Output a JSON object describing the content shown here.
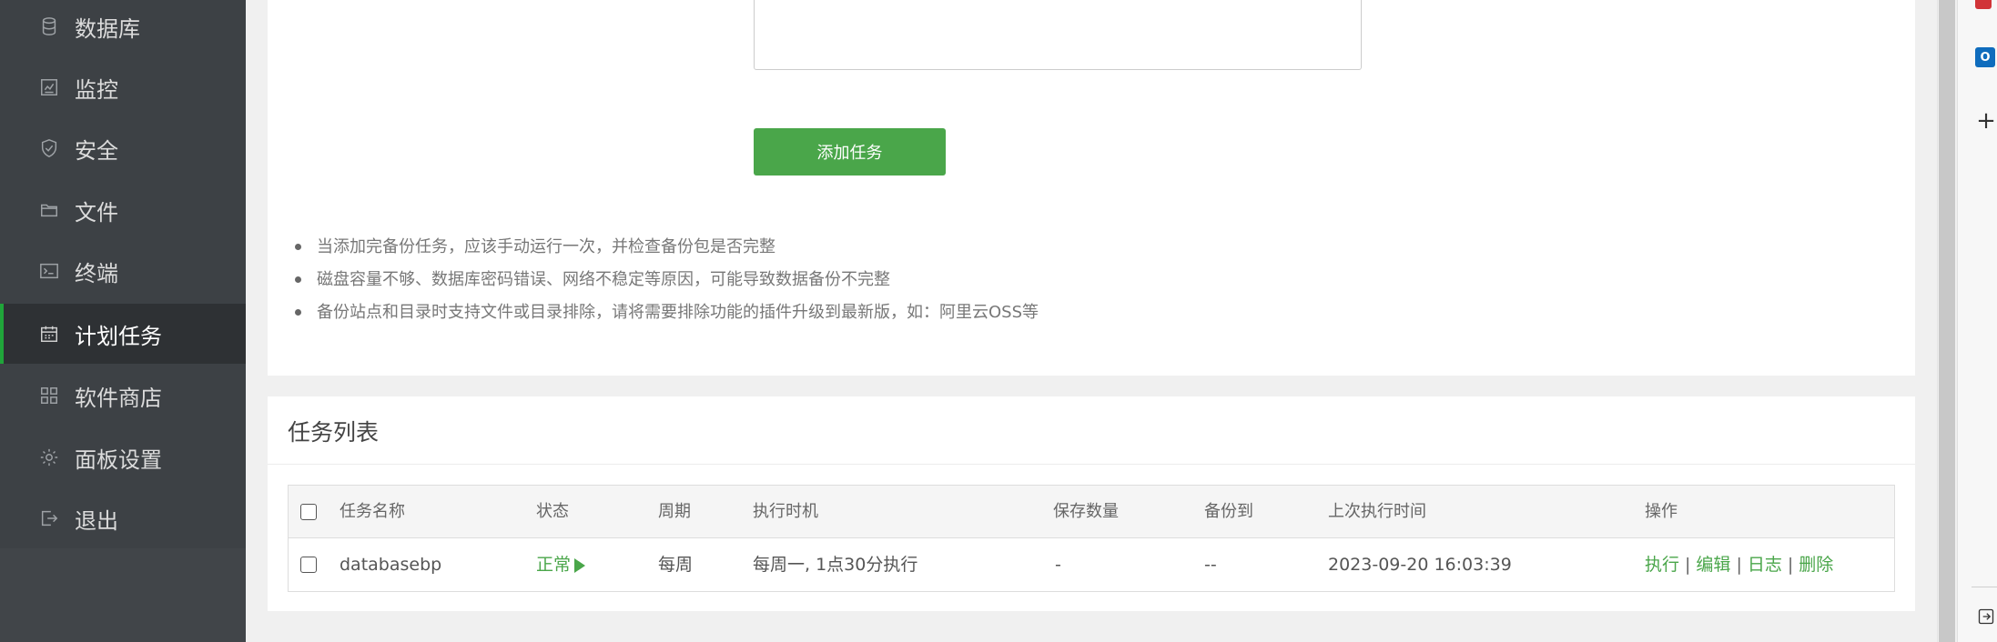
{
  "sidebar": {
    "items": [
      {
        "label": "数据库",
        "icon": "database-icon"
      },
      {
        "label": "监控",
        "icon": "monitor-icon"
      },
      {
        "label": "安全",
        "icon": "shield-icon"
      },
      {
        "label": "文件",
        "icon": "folder-icon"
      },
      {
        "label": "终端",
        "icon": "terminal-icon"
      },
      {
        "label": "计划任务",
        "icon": "calendar-icon",
        "active": true
      },
      {
        "label": "软件商店",
        "icon": "apps-grid-icon"
      },
      {
        "label": "面板设置",
        "icon": "gear-icon"
      },
      {
        "label": "退出",
        "icon": "logout-icon"
      }
    ]
  },
  "form": {
    "add_task_label": "添加任务"
  },
  "tips": [
    "当添加完备份任务，应该手动运行一次，并检查备份包是否完整",
    "磁盘容量不够、数据库密码错误、网络不稳定等原因，可能导致数据备份不完整",
    "备份站点和目录时支持文件或目录排除，请将需要排除功能的插件升级到最新版，如：阿里云OSS等"
  ],
  "task_list": {
    "title": "任务列表",
    "columns": {
      "name": "任务名称",
      "status": "状态",
      "period": "周期",
      "exec_time": "执行时机",
      "keep_count": "保存数量",
      "backup_to": "备份到",
      "last_run": "上次执行时间",
      "actions": "操作"
    },
    "rows": [
      {
        "name": "databasebp",
        "status": "正常",
        "period": "每周",
        "exec_time": "每周一, 1点30分执行",
        "keep_count": "-",
        "backup_to": "--",
        "last_run": "2023-09-20 16:03:39",
        "actions": {
          "run": "执行",
          "edit": "编辑",
          "log": "日志",
          "delete": "删除",
          "separator": "|"
        }
      }
    ]
  },
  "browser_sidebar": {
    "outlook_letter": "O",
    "plus_glyph": "+"
  },
  "colors": {
    "sidebar_bg": "#3d4145",
    "accent_green": "#4aa64a",
    "active_border": "#20a53a"
  }
}
